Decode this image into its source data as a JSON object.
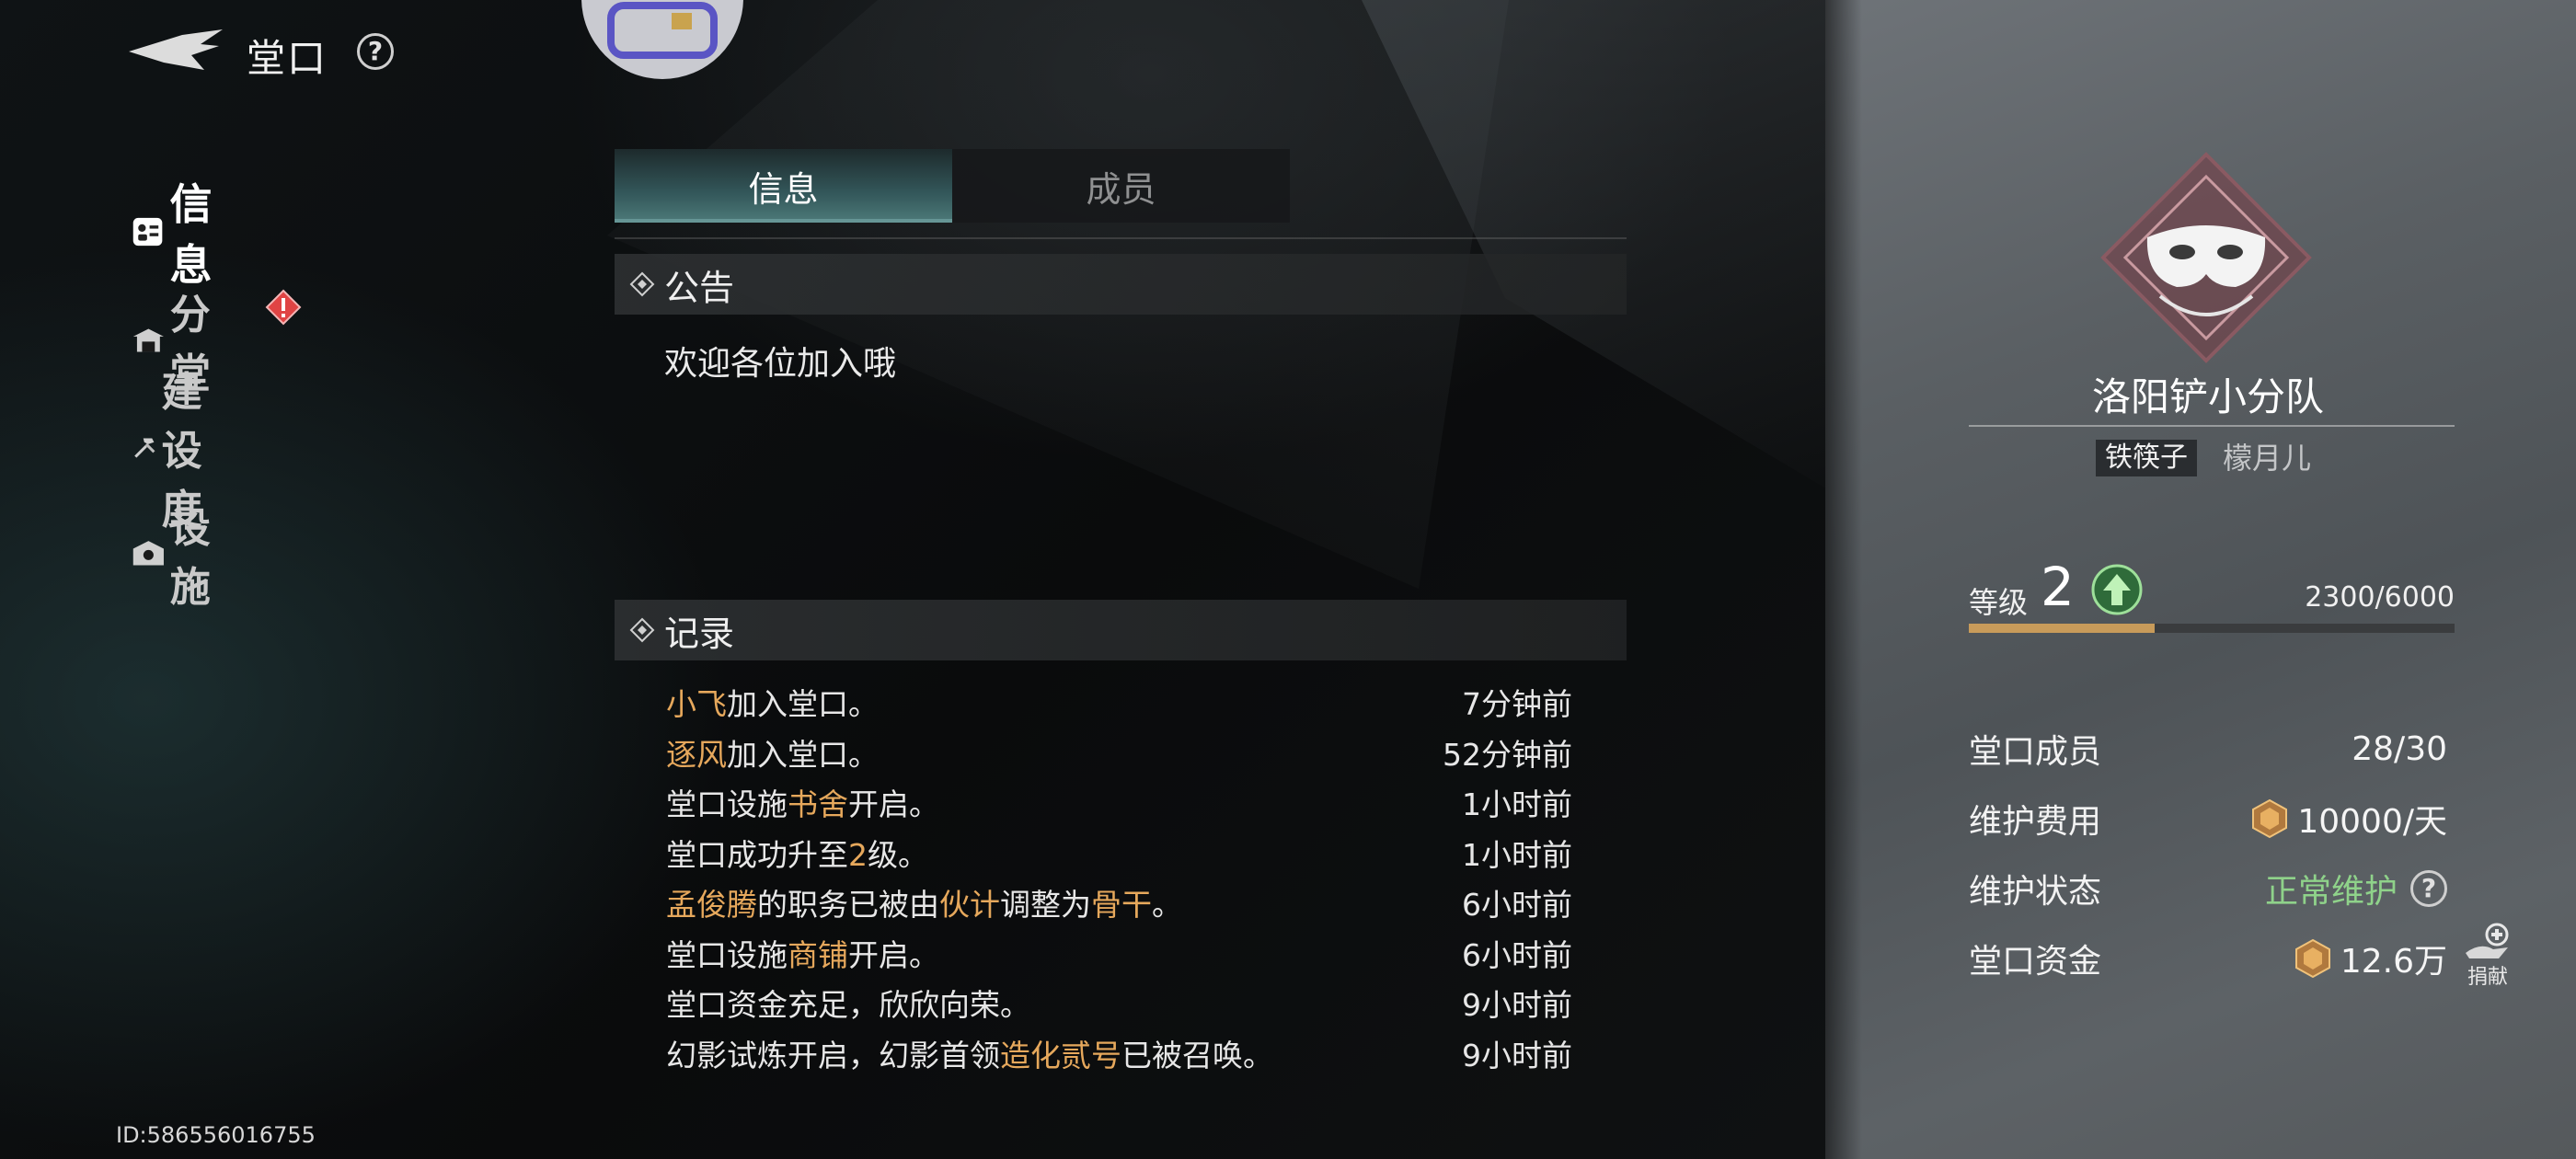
{
  "header": {
    "title": "堂口"
  },
  "nav": {
    "items": [
      {
        "label": "信息",
        "icon": "info-card-icon",
        "active": true
      },
      {
        "label": "分堂",
        "icon": "branch-hall-icon",
        "active": false,
        "alert": true
      },
      {
        "label": "建设度",
        "icon": "hammer-tools-icon",
        "active": false
      },
      {
        "label": "设施",
        "icon": "facility-icon",
        "active": false
      }
    ]
  },
  "tabs": [
    {
      "label": "信息",
      "active": true
    },
    {
      "label": "成员",
      "active": false
    }
  ],
  "notice": {
    "heading": "公告",
    "text": "欢迎各位加入哦"
  },
  "records": {
    "heading": "记录",
    "items": [
      {
        "parts": [
          {
            "t": "小飞",
            "hl": true
          },
          {
            "t": "加入堂口。",
            "hl": false
          }
        ],
        "time": "7分钟前"
      },
      {
        "parts": [
          {
            "t": "逐风",
            "hl": true
          },
          {
            "t": "加入堂口。",
            "hl": false
          }
        ],
        "time": "52分钟前"
      },
      {
        "parts": [
          {
            "t": "堂口设施",
            "hl": false
          },
          {
            "t": "书舍",
            "hl": true
          },
          {
            "t": "开启。",
            "hl": false
          }
        ],
        "time": "1小时前"
      },
      {
        "parts": [
          {
            "t": "堂口成功升至",
            "hl": false
          },
          {
            "t": "2",
            "hl": true
          },
          {
            "t": "级。",
            "hl": false
          }
        ],
        "time": "1小时前"
      },
      {
        "parts": [
          {
            "t": "孟俊腾",
            "hl": true
          },
          {
            "t": "的职务已被由",
            "hl": false
          },
          {
            "t": "伙计",
            "hl": true
          },
          {
            "t": "调整为",
            "hl": false
          },
          {
            "t": "骨干",
            "hl": true
          },
          {
            "t": "。",
            "hl": false
          }
        ],
        "time": "6小时前"
      },
      {
        "parts": [
          {
            "t": "堂口设施",
            "hl": false
          },
          {
            "t": "商铺",
            "hl": true
          },
          {
            "t": "开启。",
            "hl": false
          }
        ],
        "time": "6小时前"
      },
      {
        "parts": [
          {
            "t": "堂口资金充足，欣欣向荣。",
            "hl": false
          }
        ],
        "time": "9小时前"
      },
      {
        "parts": [
          {
            "t": "幻影试炼开启，幻影首领",
            "hl": false
          },
          {
            "t": "造化贰号",
            "hl": true
          },
          {
            "t": "已被召唤。",
            "hl": false
          }
        ],
        "time": "9小时前"
      }
    ]
  },
  "user_id": "ID:586556016755",
  "guild": {
    "name": "洛阳铲小分队",
    "role": "铁筷子",
    "leader": "檬月儿",
    "level_label": "等级",
    "level": "2",
    "exp_text": "2300/6000",
    "exp_fraction": 0.3833,
    "stats": [
      {
        "key": "堂口成员",
        "value": "28/30"
      },
      {
        "key": "维护费用",
        "value": "10000/天",
        "icon": "coin-icon"
      },
      {
        "key": "维护状态",
        "value": "正常维护",
        "status": true
      },
      {
        "key": "堂口资金",
        "value": "12.6万",
        "icon": "coin-icon"
      }
    ],
    "donate_label": "捐献"
  },
  "colors": {
    "highlight": "#e6a85c",
    "status_ok": "#8fd28a",
    "exp_bar": "#c89b5a"
  }
}
